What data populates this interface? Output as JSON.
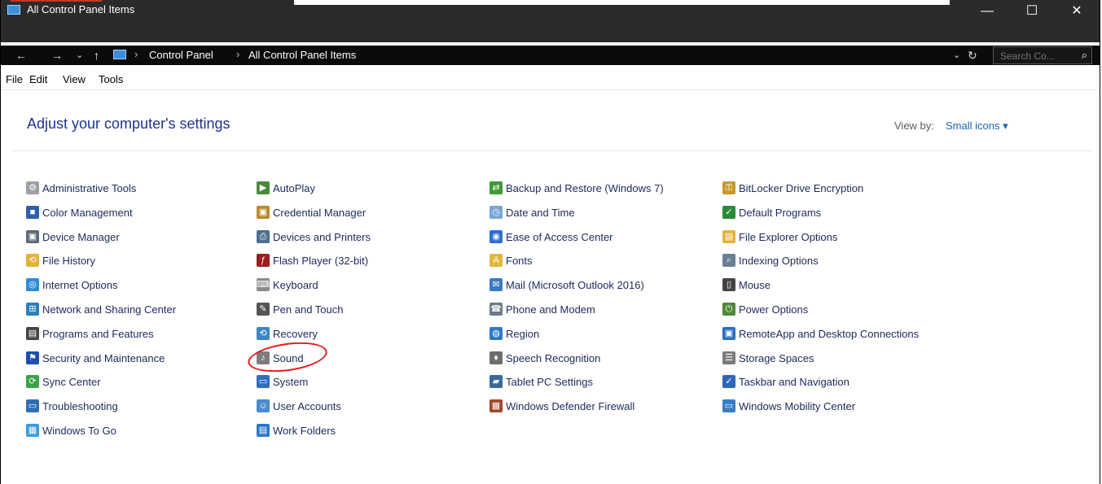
{
  "window": {
    "title": "All Control Panel Items",
    "controls": {
      "minimize": "—",
      "maximize": "☐",
      "close": "✕"
    }
  },
  "addressbar": {
    "back": "←",
    "forward": "→",
    "recent": "⌄",
    "up": "↑",
    "crumbs": [
      "Control Panel",
      "All Control Panel Items"
    ],
    "separator": "›",
    "dropdown": "⌄",
    "refresh": "↻",
    "search_placeholder": "Search Co...",
    "search_icon": "⌕"
  },
  "menubar": [
    "File",
    "Edit",
    "View",
    "Tools"
  ],
  "header": {
    "title": "Adjust your computer's settings",
    "view_by_label": "View by:",
    "view_by_value": "Small icons ▾"
  },
  "columns": [
    [
      {
        "label": "Administrative Tools",
        "icon": "admin-tools-icon",
        "color": "#9aa0a6",
        "glyph": "⚙"
      },
      {
        "label": "Color Management",
        "icon": "color-management-icon",
        "color": "#2f5fa8",
        "glyph": "■"
      },
      {
        "label": "Device Manager",
        "icon": "device-manager-icon",
        "color": "#5b6a7a",
        "glyph": "▣"
      },
      {
        "label": "File History",
        "icon": "file-history-icon",
        "color": "#e2b33b",
        "glyph": "⟲"
      },
      {
        "label": "Internet Options",
        "icon": "internet-options-icon",
        "color": "#2e8bd6",
        "glyph": "◎"
      },
      {
        "label": "Network and Sharing Center",
        "icon": "network-icon",
        "color": "#2a7fbf",
        "glyph": "⊞"
      },
      {
        "label": "Programs and Features",
        "icon": "programs-icon",
        "color": "#444444",
        "glyph": "▤"
      },
      {
        "label": "Security and Maintenance",
        "icon": "flag-icon",
        "color": "#1c4fb0",
        "glyph": "⚑"
      },
      {
        "label": "Sync Center",
        "icon": "sync-icon",
        "color": "#3aa245",
        "glyph": "⟳"
      },
      {
        "label": "Troubleshooting",
        "icon": "troubleshooting-icon",
        "color": "#2d6fb4",
        "glyph": "▭"
      },
      {
        "label": "Windows To Go",
        "icon": "windows-to-go-icon",
        "color": "#3b9ae1",
        "glyph": "▦"
      }
    ],
    [
      {
        "label": "AutoPlay",
        "icon": "autoplay-icon",
        "color": "#4a8a3a",
        "glyph": "▶"
      },
      {
        "label": "Credential Manager",
        "icon": "credential-icon",
        "color": "#b88a2d",
        "glyph": "▣"
      },
      {
        "label": "Devices and Printers",
        "icon": "printer-icon",
        "color": "#4c6f8c",
        "glyph": "⎙"
      },
      {
        "label": "Flash Player (32-bit)",
        "icon": "flash-icon",
        "color": "#9b1d1d",
        "glyph": "ƒ"
      },
      {
        "label": "Keyboard",
        "icon": "keyboard-icon",
        "color": "#8a8a8a",
        "glyph": "⌨"
      },
      {
        "label": "Pen and Touch",
        "icon": "pen-icon",
        "color": "#555555",
        "glyph": "✎"
      },
      {
        "label": "Recovery",
        "icon": "recovery-icon",
        "color": "#3f86c7",
        "glyph": "⟲"
      },
      {
        "label": "Sound",
        "icon": "speaker-icon",
        "color": "#7d7d7d",
        "glyph": "♪"
      },
      {
        "label": "System",
        "icon": "system-icon",
        "color": "#2f6fbf",
        "glyph": "▭"
      },
      {
        "label": "User Accounts",
        "icon": "user-accounts-icon",
        "color": "#4a8ad4",
        "glyph": "☺"
      },
      {
        "label": "Work Folders",
        "icon": "work-folders-icon",
        "color": "#2c79c8",
        "glyph": "▤"
      }
    ],
    [
      {
        "label": "Backup and Restore (Windows 7)",
        "icon": "backup-icon",
        "color": "#3f9a3a",
        "glyph": "⇄"
      },
      {
        "label": "Date and Time",
        "icon": "clock-icon",
        "color": "#7aa7d6",
        "glyph": "◷"
      },
      {
        "label": "Ease of Access Center",
        "icon": "ease-of-access-icon",
        "color": "#2a6fd0",
        "glyph": "◉"
      },
      {
        "label": "Fonts",
        "icon": "fonts-icon",
        "color": "#e0b740",
        "glyph": "A"
      },
      {
        "label": "Mail (Microsoft Outlook 2016)",
        "icon": "mail-icon",
        "color": "#3a7ac0",
        "glyph": "✉"
      },
      {
        "label": "Phone and Modem",
        "icon": "phone-icon",
        "color": "#6b7a88",
        "glyph": "☎"
      },
      {
        "label": "Region",
        "icon": "region-icon",
        "color": "#2f79c8",
        "glyph": "◍"
      },
      {
        "label": "Speech Recognition",
        "icon": "microphone-icon",
        "color": "#6d6d6d",
        "glyph": "♦"
      },
      {
        "label": "Tablet PC Settings",
        "icon": "tablet-icon",
        "color": "#3a6a9c",
        "glyph": "▰"
      },
      {
        "label": "Windows Defender Firewall",
        "icon": "firewall-icon",
        "color": "#a3472a",
        "glyph": "▦"
      }
    ],
    [
      {
        "label": "BitLocker Drive Encryption",
        "icon": "bitlocker-icon",
        "color": "#c79a2a",
        "glyph": "⚿"
      },
      {
        "label": "Default Programs",
        "icon": "default-programs-icon",
        "color": "#2a8a3a",
        "glyph": "✓"
      },
      {
        "label": "File Explorer Options",
        "icon": "explorer-options-icon",
        "color": "#e3b43a",
        "glyph": "▤"
      },
      {
        "label": "Indexing Options",
        "icon": "indexing-icon",
        "color": "#6c7f92",
        "glyph": "⌕"
      },
      {
        "label": "Mouse",
        "icon": "mouse-icon",
        "color": "#444444",
        "glyph": "▯"
      },
      {
        "label": "Power Options",
        "icon": "power-icon",
        "color": "#4d8a3a",
        "glyph": "⏻"
      },
      {
        "label": "RemoteApp and Desktop Connections",
        "icon": "remoteapp-icon",
        "color": "#2a6fbf",
        "glyph": "▣"
      },
      {
        "label": "Storage Spaces",
        "icon": "storage-icon",
        "color": "#7a7a7a",
        "glyph": "☰"
      },
      {
        "label": "Taskbar and Navigation",
        "icon": "taskbar-icon",
        "color": "#2f67b8",
        "glyph": "✓"
      },
      {
        "label": "Windows Mobility Center",
        "icon": "mobility-icon",
        "color": "#3c7cc2",
        "glyph": "▭"
      }
    ]
  ]
}
